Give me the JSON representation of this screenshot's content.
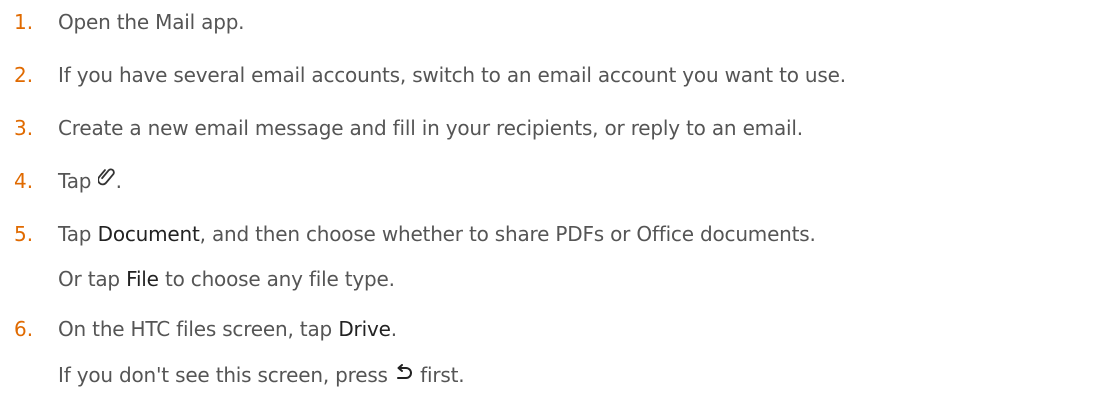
{
  "steps": [
    {
      "num": "1.",
      "text": "Open the Mail app."
    },
    {
      "num": "2.",
      "text": "If you have several email accounts, switch to an email account you want to use."
    },
    {
      "num": "3.",
      "text": "Create a new email message and fill in your recipients, or reply to an email."
    },
    {
      "num": "4.",
      "before": "Tap",
      "after": ".",
      "icon": "paperclip-icon"
    },
    {
      "num": "5.",
      "before": "Tap",
      "ui": "Document",
      "after": ", and then choose whether to share PDFs or Office documents."
    },
    {
      "num": "6.",
      "before": "On the HTC files screen, tap",
      "ui": "Drive",
      "after": "."
    }
  ],
  "continuations": {
    "step5": {
      "before": "Or tap",
      "ui": "File",
      "after": "to choose any file type."
    },
    "step6": {
      "before": "If you don't see this screen, press",
      "icon": "back-icon",
      "after": "first."
    }
  },
  "colors": {
    "number": "#e06a00",
    "body_text": "#555555",
    "ui_term": "#222222"
  }
}
